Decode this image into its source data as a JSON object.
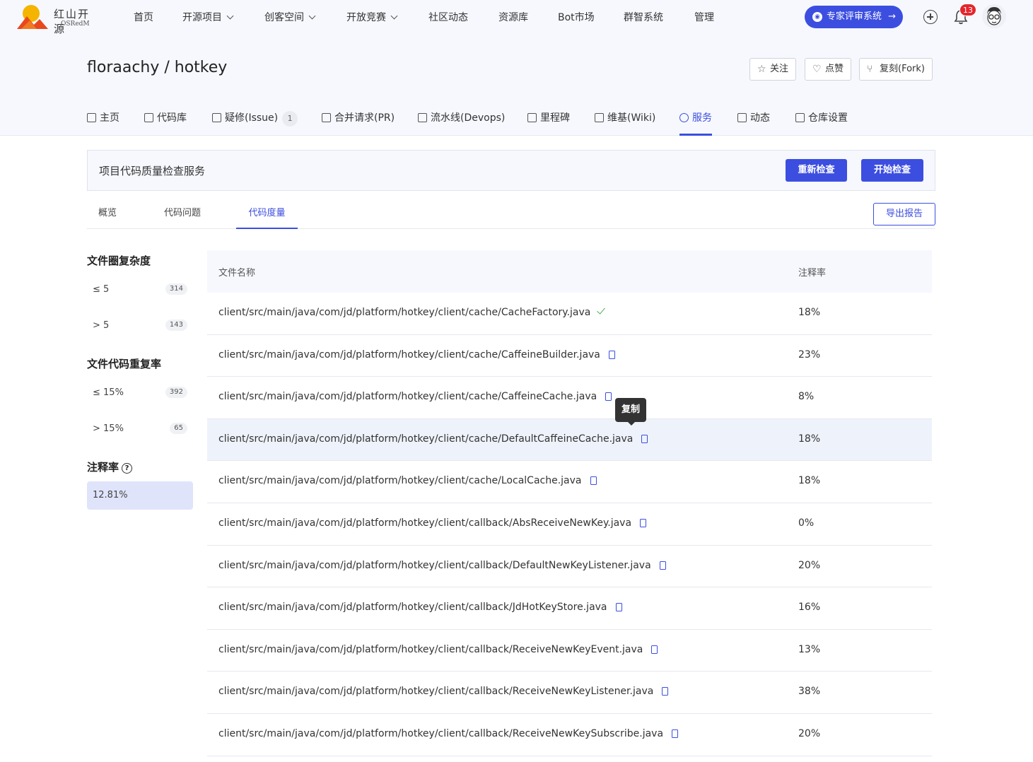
{
  "brand": {
    "name": "红山开源",
    "sub": "OSRedM"
  },
  "nav": {
    "items": [
      {
        "label": "首页",
        "dropdown": false
      },
      {
        "label": "开源项目",
        "dropdown": true
      },
      {
        "label": "创客空间",
        "dropdown": true
      },
      {
        "label": "开放竞赛",
        "dropdown": true
      },
      {
        "label": "社区动态",
        "dropdown": false
      },
      {
        "label": "资源库",
        "dropdown": false
      },
      {
        "label": "Bot市场",
        "dropdown": false
      },
      {
        "label": "群智系统",
        "dropdown": false
      },
      {
        "label": "管理",
        "dropdown": false
      }
    ],
    "expert_button": "专家评审系统",
    "notification_count": "13"
  },
  "repo": {
    "title": "floraachy / hotkey",
    "actions": {
      "watch": "关注",
      "star": "点赞",
      "fork": "复刻(Fork)"
    },
    "tabs": [
      {
        "label": "主页"
      },
      {
        "label": "代码库"
      },
      {
        "label": "疑修(Issue)",
        "count": "1"
      },
      {
        "label": "合并请求(PR)"
      },
      {
        "label": "流水线(Devops)"
      },
      {
        "label": "里程碑"
      },
      {
        "label": "维基(Wiki)"
      },
      {
        "label": "服务",
        "active": true
      },
      {
        "label": "动态"
      },
      {
        "label": "仓库设置"
      }
    ]
  },
  "service": {
    "title": "项目代码质量检查服务",
    "recheck_button": "重新检查",
    "start_button": "开始检查",
    "subtabs": [
      "概览",
      "代码问题",
      "代码度量"
    ],
    "active_subtab": "代码度量",
    "export_button": "导出报告"
  },
  "filters": {
    "complexity": {
      "title": "文件圈复杂度",
      "rows": [
        {
          "label": "≤ 5",
          "count": "314"
        },
        {
          "label": "> 5",
          "count": "143"
        }
      ]
    },
    "duplication": {
      "title": "文件代码重复率",
      "rows": [
        {
          "label": "≤ 15%",
          "count": "392"
        },
        {
          "label": "> 15%",
          "count": "65"
        }
      ]
    },
    "comment": {
      "title": "注释率",
      "help": "?",
      "value": "12.81%"
    }
  },
  "table": {
    "headers": {
      "file": "文件名称",
      "rate": "注释率"
    },
    "rows": [
      {
        "file": "client/src/main/java/com/jd/platform/hotkey/client/cache/CacheFactory.java",
        "rate": "18%",
        "icon": "check"
      },
      {
        "file": "client/src/main/java/com/jd/platform/hotkey/client/cache/CaffeineBuilder.java",
        "rate": "23%",
        "icon": "copy"
      },
      {
        "file": "client/src/main/java/com/jd/platform/hotkey/client/cache/CaffeineCache.java",
        "rate": "8%",
        "icon": "copy"
      },
      {
        "file": "client/src/main/java/com/jd/platform/hotkey/client/cache/DefaultCaffeineCache.java",
        "rate": "18%",
        "icon": "copy",
        "highlight": true
      },
      {
        "file": "client/src/main/java/com/jd/platform/hotkey/client/cache/LocalCache.java",
        "rate": "18%",
        "icon": "copy"
      },
      {
        "file": "client/src/main/java/com/jd/platform/hotkey/client/callback/AbsReceiveNewKey.java",
        "rate": "0%",
        "icon": "copy"
      },
      {
        "file": "client/src/main/java/com/jd/platform/hotkey/client/callback/DefaultNewKeyListener.java",
        "rate": "20%",
        "icon": "copy"
      },
      {
        "file": "client/src/main/java/com/jd/platform/hotkey/client/callback/JdHotKeyStore.java",
        "rate": "16%",
        "icon": "copy"
      },
      {
        "file": "client/src/main/java/com/jd/platform/hotkey/client/callback/ReceiveNewKeyEvent.java",
        "rate": "13%",
        "icon": "copy"
      },
      {
        "file": "client/src/main/java/com/jd/platform/hotkey/client/callback/ReceiveNewKeyListener.java",
        "rate": "38%",
        "icon": "copy"
      },
      {
        "file": "client/src/main/java/com/jd/platform/hotkey/client/callback/ReceiveNewKeySubscribe.java",
        "rate": "20%",
        "icon": "copy"
      }
    ],
    "tooltip": "复制"
  },
  "colors": {
    "accent": "#3c4ee0",
    "highlight_row": "#eef2fb",
    "success": "#4caf50",
    "badge": "#e4252d"
  }
}
